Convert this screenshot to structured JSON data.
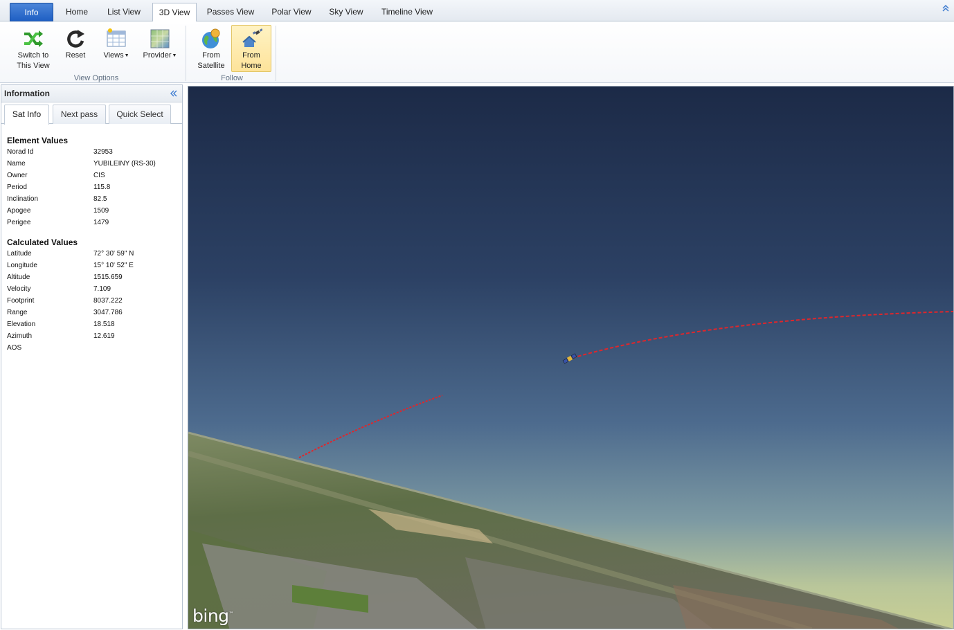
{
  "tabs": [
    {
      "label": "Info",
      "app": true
    },
    {
      "label": "Home"
    },
    {
      "label": "List View"
    },
    {
      "label": "3D View",
      "active": true
    },
    {
      "label": "Passes View"
    },
    {
      "label": "Polar View"
    },
    {
      "label": "Sky View"
    },
    {
      "label": "Timeline View"
    }
  ],
  "ribbon": {
    "view_options": {
      "label": "View Options",
      "switch": {
        "line1": "Switch to",
        "line2": "This View",
        "icon": "shuffle-icon"
      },
      "reset": {
        "line1": "Reset",
        "icon": "reset-icon"
      },
      "views": {
        "line1": "Views",
        "icon": "views-grid-icon"
      },
      "provider": {
        "line1": "Provider",
        "icon": "provider-map-icon"
      }
    },
    "follow": {
      "label": "Follow",
      "satellite": {
        "line1": "From",
        "line2": "Satellite",
        "icon": "globe-satellite-icon"
      },
      "home": {
        "line1": "From",
        "line2": "Home",
        "icon": "home-satellite-icon"
      }
    }
  },
  "info_panel": {
    "title": "Information",
    "subtabs": [
      "Sat Info",
      "Next pass",
      "Quick Select"
    ],
    "element_values": {
      "title": "Element Values",
      "rows": [
        {
          "k": "Norad Id",
          "v": "32953"
        },
        {
          "k": "Name",
          "v": "YUBILEINY (RS-30)"
        },
        {
          "k": "Owner",
          "v": "CIS"
        },
        {
          "k": "Period",
          "v": "115.8"
        },
        {
          "k": "Inclination",
          "v": "82.5"
        },
        {
          "k": "Apogee",
          "v": "1509"
        },
        {
          "k": "Perigee",
          "v": "1479"
        }
      ]
    },
    "calculated_values": {
      "title": "Calculated Values",
      "rows": [
        {
          "k": "Latitude",
          "v": "72° 30' 59\" N"
        },
        {
          "k": "Longitude",
          "v": "15° 10' 52\" E"
        },
        {
          "k": "Altitude",
          "v": "1515.659"
        },
        {
          "k": "Velocity",
          "v": "7.109"
        },
        {
          "k": "Footprint",
          "v": "8037.222"
        },
        {
          "k": "Range",
          "v": "3047.786"
        },
        {
          "k": "Elevation",
          "v": "18.518"
        },
        {
          "k": "Azimuth",
          "v": "12.619"
        },
        {
          "k": "AOS",
          "v": ""
        }
      ]
    }
  },
  "viewport": {
    "provider_logo": "bing",
    "orbit_color": "#e0262b"
  }
}
